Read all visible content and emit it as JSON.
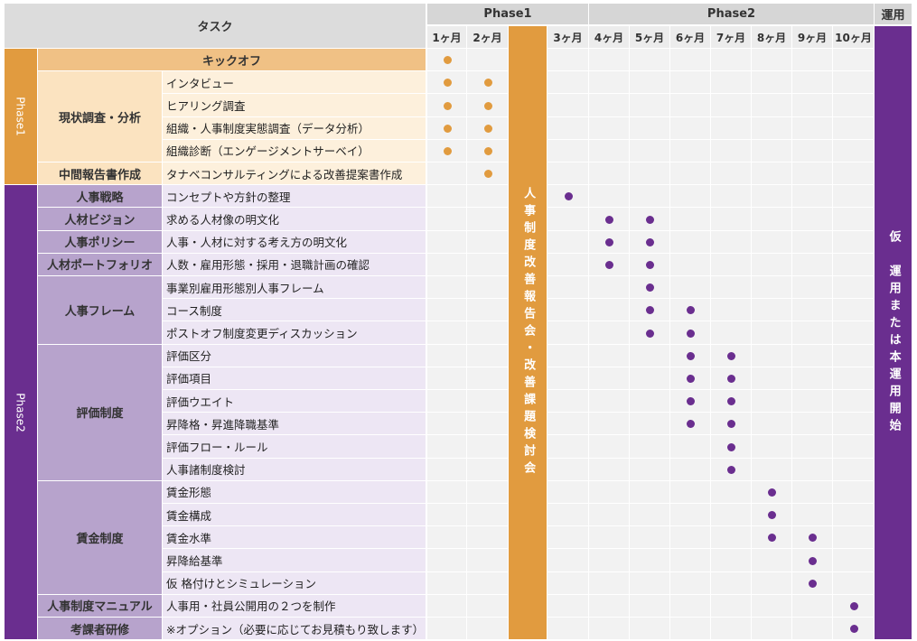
{
  "header": {
    "task_label": "タスク",
    "phase1": "Phase1",
    "phase2": "Phase2",
    "ops": "運用"
  },
  "months": [
    "1ヶ月",
    "2ヶ月",
    "",
    "3ヶ月",
    "4ヶ月",
    "5ヶ月",
    "6ヶ月",
    "7ヶ月",
    "8ヶ月",
    "9ヶ月",
    "10ヶ月"
  ],
  "phase_labels": {
    "p1": "Phase1",
    "p2": "Phase2"
  },
  "kickoff": "キックオフ",
  "groups": [
    {
      "label": "現状調査・分析",
      "phase": 1,
      "rows": [
        1,
        4
      ]
    },
    {
      "label": "中間報告書作成",
      "phase": 1,
      "rows": [
        5,
        5
      ]
    },
    {
      "label": "人事戦略",
      "phase": 2,
      "rows": [
        6,
        6
      ]
    },
    {
      "label": "人材ビジョン",
      "phase": 2,
      "rows": [
        7,
        7
      ]
    },
    {
      "label": "人事ポリシー",
      "phase": 2,
      "rows": [
        8,
        8
      ]
    },
    {
      "label": "人材ポートフォリオ",
      "phase": 2,
      "rows": [
        9,
        9
      ]
    },
    {
      "label": "人事フレーム",
      "phase": 2,
      "rows": [
        10,
        12
      ]
    },
    {
      "label": "評価制度",
      "phase": 2,
      "rows": [
        13,
        18
      ]
    },
    {
      "label": "賃金制度",
      "phase": 2,
      "rows": [
        19,
        23
      ]
    },
    {
      "label": "人事制度マニュアル",
      "phase": 2,
      "rows": [
        24,
        24
      ]
    },
    {
      "label": "考課者研修",
      "phase": 2,
      "rows": [
        25,
        25
      ]
    }
  ],
  "tasks": [
    "",
    "インタビュー",
    "ヒアリング調査",
    "組織・人事制度実態調査（データ分析）",
    "組織診断（エンゲージメントサーベイ）",
    "タナベコンサルティングによる改善提案書作成",
    "コンセプトや方針の整理",
    "求める人材像の明文化",
    "人事・人材に対する考え方の明文化",
    "人数・雇用形態・採用・退職計画の確認",
    "事業別雇用形態別人事フレーム",
    "コース制度",
    "ポストオフ制度変更ディスカッション",
    "評価区分",
    "評価項目",
    "評価ウエイト",
    "昇降格・昇進降職基準",
    "評価フロー・ルール",
    "人事諸制度検討",
    "賃金形態",
    "賃金構成",
    "賃金水準",
    "昇降給基準",
    "仮 格付けとシミュレーション",
    "人事用・社員公開用の２つを制作",
    "※オプション（必要に応じてお見積もり致します）"
  ],
  "schedule": [
    [
      0
    ],
    [
      0,
      1
    ],
    [
      0,
      1
    ],
    [
      0,
      1
    ],
    [
      0,
      1
    ],
    [
      1
    ],
    [
      3
    ],
    [
      4,
      5
    ],
    [
      4,
      5
    ],
    [
      4,
      5
    ],
    [
      5
    ],
    [
      5,
      6
    ],
    [
      5,
      6
    ],
    [
      6,
      7
    ],
    [
      6,
      7
    ],
    [
      6,
      7
    ],
    [
      6,
      7
    ],
    [
      7
    ],
    [
      7
    ],
    [
      8
    ],
    [
      8
    ],
    [
      8,
      9
    ],
    [
      9
    ],
    [
      9
    ],
    [
      10
    ],
    [
      10
    ]
  ],
  "band_meeting": "人事制度改善報告会・改善課題検討会",
  "band_ops": "仮　運用または本運用開始",
  "colors": {
    "p1_dark": "#e19b3f",
    "p1_mid": "#f0c185",
    "p1_light": "#fdf0dc",
    "p2_dark": "#6a2e8f",
    "p2_mid": "#b7a3cc",
    "p2_light": "#ede6f4",
    "dot_orange": "#e19b3f",
    "dot_purple": "#6a2e8f"
  }
}
